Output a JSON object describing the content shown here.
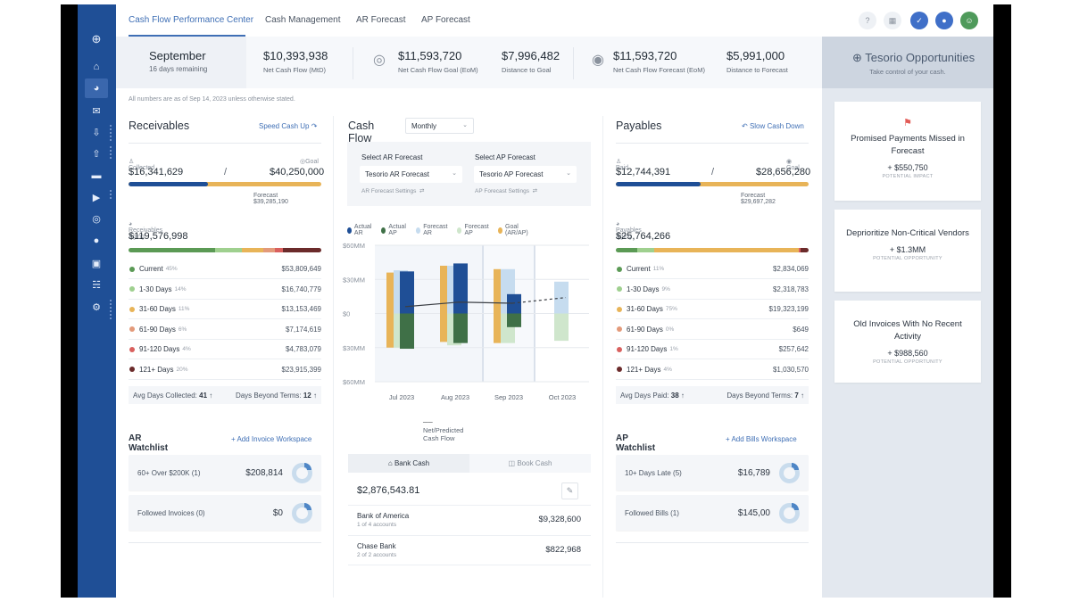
{
  "nav": {
    "tabs": [
      {
        "label": "Cash Flow Performance Center",
        "active": true
      },
      {
        "label": "Cash Management",
        "active": false
      },
      {
        "label": "AR Forecast",
        "active": false
      },
      {
        "label": "AP Forecast",
        "active": false
      }
    ],
    "toolbar": {
      "help": "?",
      "apps": "apps-icon",
      "tasks": "check-icon",
      "notifications": "bell-icon",
      "profile": "user-icon"
    }
  },
  "sidebar": {
    "items": [
      "logo-icon",
      "home-icon",
      "dashboard-icon",
      "inbox-icon",
      "receivables-icon",
      "payables-icon",
      "card-icon",
      "campaign-icon",
      "target-icon",
      "insight-icon",
      "reconcile-icon",
      "bank-icon",
      "settings-icon"
    ]
  },
  "kpis": {
    "month": "September",
    "days_remaining": "16 days remaining",
    "items": [
      {
        "value": "$10,393,938",
        "label": "Net Cash Flow (MtD)"
      },
      {
        "value": "$11,593,720",
        "label": "Net Cash Flow Goal (EoM)"
      },
      {
        "value": "$7,996,482",
        "label": "Distance to Goal"
      },
      {
        "value": "$11,593,720",
        "label": "Net Cash Flow Forecast (EoM)"
      },
      {
        "value": "$5,991,000",
        "label": "Distance to Forecast"
      }
    ]
  },
  "note": "All numbers are as of Sep 14, 2023 unless otherwise stated.",
  "receivables": {
    "title": "Receivables",
    "action": "Speed Cash Up",
    "collected_label": "Collected",
    "collected": "$16,341,629",
    "goal_label": "Goal",
    "goal": "$40,250,000",
    "progress_fraction": 0.41,
    "forecast": "Forecast $39,285,190",
    "aging_label": "Receivables Aging",
    "aging_total": "$119,576,998",
    "aging": [
      {
        "name": "Current",
        "pct": "45%",
        "value": "$53,809,649",
        "color": "#5b9a55",
        "share": 45
      },
      {
        "name": "1-30 Days",
        "pct": "14%",
        "value": "$16,740,779",
        "color": "#9fd08f",
        "share": 14
      },
      {
        "name": "31-60 Days",
        "pct": "11%",
        "value": "$13,153,469",
        "color": "#e8b458",
        "share": 11
      },
      {
        "name": "61-90 Days",
        "pct": "6%",
        "value": "$7,174,619",
        "color": "#e39a7a",
        "share": 6
      },
      {
        "name": "91-120 Days",
        "pct": "4%",
        "value": "$4,783,079",
        "color": "#d9605e",
        "share": 4
      },
      {
        "name": "121+ Days",
        "pct": "20%",
        "value": "$23,915,399",
        "color": "#6b2b2b",
        "share": 20
      }
    ],
    "stat1_label": "Avg Days Collected:",
    "stat1_value": "41",
    "stat2_label": "Days Beyond Terms:",
    "stat2_value": "12",
    "watchlist_title": "AR Watchlist",
    "watchlist_action": "Add Invoice Workspace",
    "watchlist": [
      {
        "name": "60+ Over $200K (1)",
        "value": "$208,814"
      },
      {
        "name": "Followed Invoices (0)",
        "value": "$0"
      }
    ]
  },
  "cashflow": {
    "title": "Cash Flow",
    "period": "Monthly",
    "ar_label": "Select AR Forecast",
    "ar_value": "Tesorio AR Forecast",
    "ar_settings": "AR Forecast Settings",
    "ap_label": "Select AP Forecast",
    "ap_value": "Tesorio AP Forecast",
    "ap_settings": "AP Forecast Settings",
    "net_label": "Net/Predicted Cash Flow",
    "cash_tabs": [
      {
        "label": "Bank Cash",
        "active": true
      },
      {
        "label": "Book Cash",
        "active": false
      }
    ],
    "cash_total": "$2,876,543.81",
    "banks": [
      {
        "name": "Bank of America",
        "accounts": "1 of 4 accounts",
        "value": "$9,328,600"
      },
      {
        "name": "Chase Bank",
        "accounts": "2 of 2 accounts",
        "value": "$822,968"
      }
    ]
  },
  "chart_data": {
    "type": "bar",
    "title": "Cash Flow",
    "categories": [
      "Jul 2023",
      "Aug 2023",
      "Sep 2023",
      "Oct 2023"
    ],
    "yticks": [
      "$60MM",
      "$30MM",
      "$0",
      "$30MM",
      "$60MM"
    ],
    "ylim": [
      -60,
      60
    ],
    "unit": "$MM",
    "legend": [
      {
        "name": "Actual AR",
        "color": "#1f4f96"
      },
      {
        "name": "Actual AP",
        "color": "#3f7047"
      },
      {
        "name": "Forecast AR",
        "color": "#c6dcef"
      },
      {
        "name": "Forecast AP",
        "color": "#cfe6cc"
      },
      {
        "name": "Goal (AR/AP)",
        "color": "#e8b458"
      }
    ],
    "series": [
      {
        "name": "Goal AR",
        "values": [
          36,
          42,
          39,
          null
        ]
      },
      {
        "name": "Goal AP",
        "values": [
          -30,
          -25,
          -26,
          null
        ]
      },
      {
        "name": "Forecast AR",
        "values": [
          38,
          42,
          39,
          28
        ]
      },
      {
        "name": "Forecast AP",
        "values": [
          -30,
          -28,
          -26,
          -24
        ]
      },
      {
        "name": "Actual AR",
        "values": [
          37,
          44,
          17,
          null
        ]
      },
      {
        "name": "Actual AP",
        "values": [
          -31,
          -26,
          -12,
          null
        ]
      },
      {
        "name": "Net/Predicted Cash Flow",
        "values": [
          6,
          10,
          9,
          14
        ]
      }
    ],
    "highlight": "Sep 2023",
    "legend_position": "top"
  },
  "payables": {
    "title": "Payables",
    "action": "Slow Cash Down",
    "paid_label": "Paid",
    "paid": "$12,744,391",
    "goal_label": "Goal",
    "goal": "$28,656,280",
    "progress_fraction": 0.44,
    "forecast": "Forecast $29,697,282",
    "aging_label": "Payables Aging",
    "aging_total": "$25,764,266",
    "aging": [
      {
        "name": "Current",
        "pct": "11%",
        "value": "$2,834,069",
        "color": "#5b9a55",
        "share": 11
      },
      {
        "name": "1-30 Days",
        "pct": "9%",
        "value": "$2,318,783",
        "color": "#9fd08f",
        "share": 9
      },
      {
        "name": "31-60 Days",
        "pct": "75%",
        "value": "$19,323,199",
        "color": "#e8b458",
        "share": 75
      },
      {
        "name": "61-90 Days",
        "pct": "0%",
        "value": "$649",
        "color": "#e39a7a",
        "share": 0.3
      },
      {
        "name": "91-120 Days",
        "pct": "1%",
        "value": "$257,642",
        "color": "#d9605e",
        "share": 1
      },
      {
        "name": "121+ Days",
        "pct": "4%",
        "value": "$1,030,570",
        "color": "#6b2b2b",
        "share": 4
      }
    ],
    "stat1_label": "Avg Days Paid:",
    "stat1_value": "38",
    "stat2_label": "Days Beyond Terms:",
    "stat2_value": "7",
    "watchlist_title": "AP Watchlist",
    "watchlist_action": "Add Bills Workspace",
    "watchlist": [
      {
        "name": "10+ Days Late (5)",
        "value": "$16,789"
      },
      {
        "name": "Followed Bills (1)",
        "value": "$145,00"
      }
    ]
  },
  "opportunities": {
    "title": "Tesorio Opportunities",
    "subtitle": "Take control of your cash.",
    "cards": [
      {
        "title": "Promised Payments Missed in Forecast",
        "value": "+ $550,750",
        "label": "POTENTIAL IMPACT",
        "flag": true
      },
      {
        "title": "Deprioritize Non-Critical Vendors",
        "value": "+ $1.3MM",
        "label": "POTENTIAL OPPORTUNITY",
        "flag": false
      },
      {
        "title": "Old Invoices With No Recent Activity",
        "value": "+ $988,560",
        "label": "POTENTIAL OPPORTUNITY",
        "flag": false
      }
    ]
  },
  "colors": {
    "brand": "#1f4f96",
    "accent": "#3f6fb5",
    "goal": "#e8b458"
  }
}
